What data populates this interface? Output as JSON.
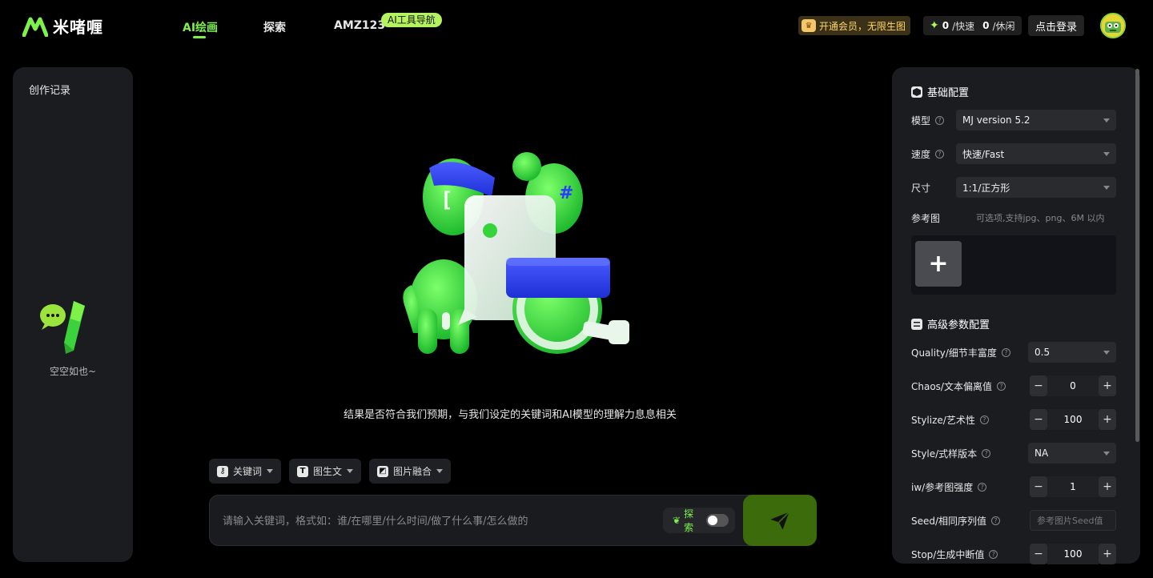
{
  "brand": {
    "name": "米啫喱"
  },
  "nav": {
    "items": [
      {
        "label": "AI绘画"
      },
      {
        "label": "探索"
      },
      {
        "label": "AMZ123"
      }
    ],
    "badge": "AI工具导航"
  },
  "header": {
    "vip_label": "开通会员，无限生图",
    "quota": {
      "fast_count": "0",
      "fast_label": "/快速",
      "relax_count": "0",
      "relax_label": "/休闲"
    },
    "login_label": "点击登录"
  },
  "left_panel": {
    "title": "创作记录",
    "empty_text": "空空如也~"
  },
  "main": {
    "caption": "结果是否符合我们预期，与我们设定的关键词和AI模型的理解力息息相关",
    "modes": [
      {
        "label": "关键词",
        "icon": "key-icon"
      },
      {
        "label": "图生文",
        "icon": "text-icon"
      },
      {
        "label": "图片融合",
        "icon": "blend-icon"
      }
    ],
    "prompt": {
      "placeholder": "请输入关键词，格式如：谁/在哪里/什么时间/做了什么事/怎么做的",
      "value": "",
      "explore_label": "探索"
    }
  },
  "settings": {
    "basic_title": "基础配置",
    "model": {
      "label": "模型",
      "value": "MJ version 5.2"
    },
    "speed": {
      "label": "速度",
      "value": "快速/Fast"
    },
    "size": {
      "label": "尺寸",
      "value": "1:1/正方形"
    },
    "reference": {
      "label": "参考图",
      "hint": "可选项,支持jpg、png、6M 以内",
      "upload": "+"
    },
    "advanced_title": "高级参数配置",
    "quality": {
      "label": "Quality/细节丰富度",
      "value": "0.5"
    },
    "chaos": {
      "label": "Chaos/文本偏离值",
      "value": "0"
    },
    "stylize": {
      "label": "Stylize/艺术性",
      "value": "100"
    },
    "style": {
      "label": "Style/式样版本",
      "value": "NA"
    },
    "iw": {
      "label": "iw/参考图强度",
      "value": "1"
    },
    "seed": {
      "label": "Seed/相同序列值",
      "placeholder": "参考图片Seed值"
    },
    "stop": {
      "label": "Stop/生成中断值",
      "value": "100"
    },
    "minus": "−",
    "plus": "+"
  },
  "colors": {
    "accent": "#7ef14b",
    "send_button": "#3b6b0a",
    "panel": "#1b1c1f"
  }
}
